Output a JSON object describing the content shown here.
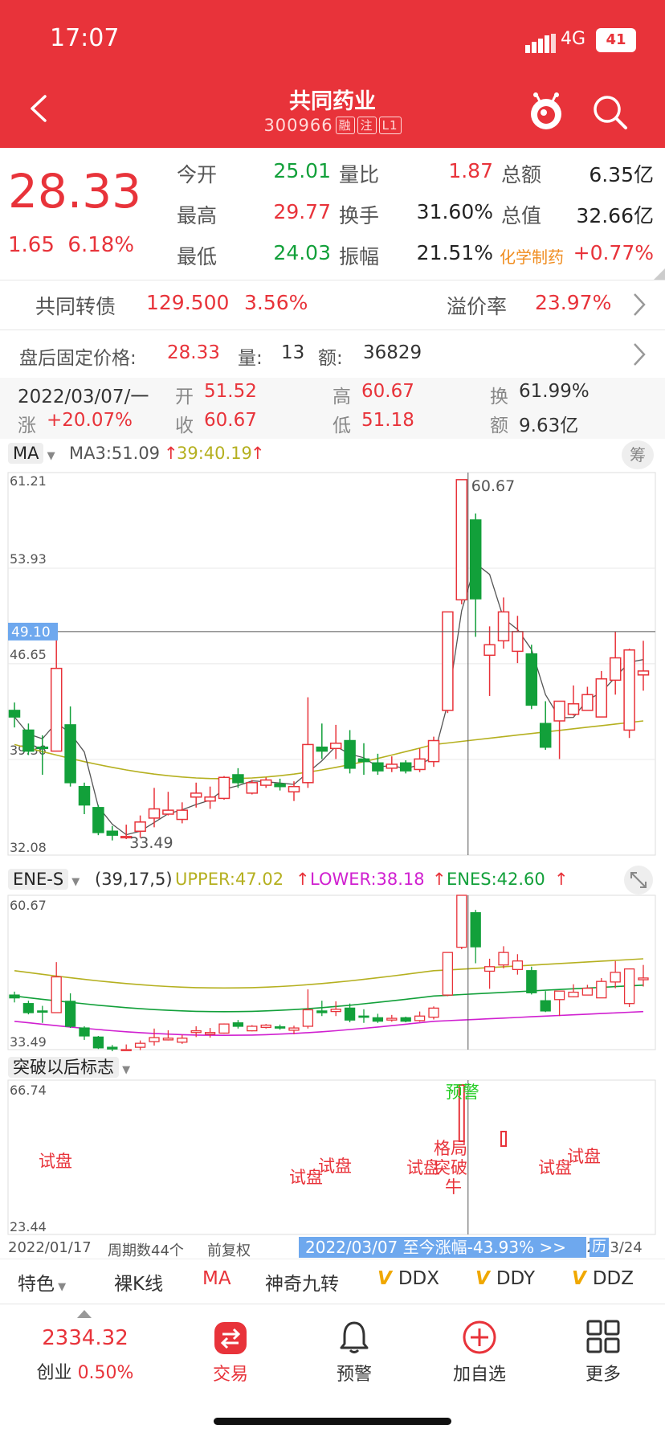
{
  "status": {
    "time": "17:07",
    "network": "4G",
    "battery": "41"
  },
  "header": {
    "title": "共同药业",
    "code": "300966",
    "tags": [
      "融",
      "注",
      "L1"
    ]
  },
  "quote": {
    "price": "28.33",
    "change": "1.65",
    "change_pct": "6.18%",
    "open_label": "今开",
    "open": "25.01",
    "high_label": "最高",
    "high": "29.77",
    "low_label": "最低",
    "low": "24.03",
    "vol_ratio_label": "量比",
    "vol_ratio": "1.87",
    "turnover_label": "换手",
    "turnover": "31.60%",
    "amp_label": "振幅",
    "amp": "21.51%",
    "amount_label": "总额",
    "amount": "6.35亿",
    "mktcap_label": "总值",
    "mktcap": "32.66亿",
    "sector": "化学制药",
    "sector_pct": "+0.77%"
  },
  "bond": {
    "name": "共同转债",
    "price": "129.500",
    "pct": "3.56%",
    "premium_label": "溢价率",
    "premium": "23.97%"
  },
  "afterhours": {
    "label": "盘后固定价格:",
    "price": "28.33",
    "vol_label": "量:",
    "vol": "13",
    "amt_label": "额:",
    "amt": "36829"
  },
  "dayinfo": {
    "date": "2022/03/07/一",
    "open_label": "开",
    "open": "51.52",
    "high_label": "高",
    "high": "60.67",
    "turn_label": "换",
    "turn": "61.99%",
    "chg_label": "涨",
    "chg": "+20.07%",
    "close_label": "收",
    "close": "60.67",
    "low_label": "低",
    "low": "51.18",
    "amt_label": "额",
    "amt": "9.63亿"
  },
  "ma_bar": {
    "selector": "MA",
    "ma3": "MA3:51.09",
    "ma39": "39:40.19",
    "chip_button": "筹"
  },
  "main_chart": {
    "axis_labels": [
      "61.21",
      "53.93",
      "46.65",
      "39.36",
      "32.08"
    ],
    "crosshair_value": "49.10",
    "high_label": "60.67",
    "low_label": "33.49"
  },
  "ene_bar": {
    "selector": "ENE-S",
    "params": "(39,17,5)",
    "upper": "UPPER:47.02",
    "lower": "LOWER:38.18",
    "enes": "ENES:42.60"
  },
  "ene_chart": {
    "axis_top": "60.67",
    "axis_bottom": "33.49"
  },
  "signal_bar": {
    "selector": "突破以后标志"
  },
  "signal_chart": {
    "axis_top": "66.74",
    "axis_bottom": "23.44",
    "labels": {
      "warn": "预警",
      "t1": "试盘",
      "t2": "试盘",
      "t3": "试盘",
      "t4": "试盘",
      "t5": "试盘",
      "t6": "试盘",
      "g": "格局",
      "b": "突破",
      "n": "牛"
    }
  },
  "footer_axis": {
    "start": "2022/01/17",
    "periods": "周期数44个",
    "adjust": "前复权",
    "banner": "2022/03/07 至今涨幅-43.93% >>",
    "cal": "历",
    "end": "2022/03/24"
  },
  "tabs": {
    "feature": "特色",
    "naked": "裸K线",
    "ma": "MA",
    "magic": "神奇九转",
    "ddx": "DDX",
    "ddy": "DDY",
    "ddz": "DDZ"
  },
  "nav": {
    "index_value": "2334.32",
    "index_name": "创业",
    "index_pct": "0.50%",
    "trade": "交易",
    "alert": "预警",
    "add": "加自选",
    "more": "更多"
  },
  "colors": {
    "red": "#e8333a",
    "green": "#12a03a",
    "ma_yellow": "#b5b020",
    "magenta": "#d020d0"
  },
  "chart_data": {
    "type": "candlestick",
    "price_range": [
      32.08,
      61.21
    ],
    "candles": [
      {
        "o": 43.1,
        "c": 42.6,
        "h": 43.7,
        "l": 41.8
      },
      {
        "o": 41.6,
        "c": 40.0,
        "h": 42.1,
        "l": 39.7
      },
      {
        "o": 40.3,
        "c": 40.2,
        "h": 41.2,
        "l": 38.2
      },
      {
        "o": 40.0,
        "c": 46.3,
        "h": 48.9,
        "l": 40.0
      },
      {
        "o": 42.0,
        "c": 37.6,
        "h": 43.4,
        "l": 37.3
      },
      {
        "o": 37.3,
        "c": 35.9,
        "h": 37.6,
        "l": 35.2
      },
      {
        "o": 35.7,
        "c": 33.8,
        "h": 35.9,
        "l": 33.6
      },
      {
        "o": 33.9,
        "c": 33.6,
        "h": 34.3,
        "l": 33.2
      },
      {
        "o": 33.4,
        "c": 33.5,
        "h": 34.4,
        "l": 33.3
      },
      {
        "o": 33.9,
        "c": 34.6,
        "h": 35.1,
        "l": 33.4
      },
      {
        "o": 34.9,
        "c": 35.6,
        "h": 37.2,
        "l": 34.2
      },
      {
        "o": 35.2,
        "c": 35.5,
        "h": 36.9,
        "l": 35.1
      },
      {
        "o": 34.8,
        "c": 35.5,
        "h": 36.1,
        "l": 34.5
      },
      {
        "o": 36.5,
        "c": 36.8,
        "h": 37.6,
        "l": 35.7
      },
      {
        "o": 36.2,
        "c": 36.5,
        "h": 37.3,
        "l": 35.6
      },
      {
        "o": 36.4,
        "c": 38.0,
        "h": 38.1,
        "l": 36.3
      },
      {
        "o": 38.2,
        "c": 37.6,
        "h": 38.7,
        "l": 37.2
      },
      {
        "o": 36.8,
        "c": 37.6,
        "h": 37.8,
        "l": 36.7
      },
      {
        "o": 37.4,
        "c": 37.8,
        "h": 38.0,
        "l": 37.2
      },
      {
        "o": 37.5,
        "c": 37.3,
        "h": 37.9,
        "l": 37.0
      },
      {
        "o": 36.9,
        "c": 37.3,
        "h": 37.7,
        "l": 36.2
      },
      {
        "o": 37.6,
        "c": 40.5,
        "h": 44.1,
        "l": 37.2
      },
      {
        "o": 40.3,
        "c": 40.0,
        "h": 42.1,
        "l": 39.4
      },
      {
        "o": 40.2,
        "c": 40.6,
        "h": 42.0,
        "l": 39.4
      },
      {
        "o": 40.8,
        "c": 38.7,
        "h": 41.6,
        "l": 38.3
      },
      {
        "o": 39.4,
        "c": 39.2,
        "h": 40.6,
        "l": 38.2
      },
      {
        "o": 39.1,
        "c": 38.5,
        "h": 39.8,
        "l": 38.2
      },
      {
        "o": 38.7,
        "c": 39.0,
        "h": 39.6,
        "l": 38.4
      },
      {
        "o": 39.1,
        "c": 38.5,
        "h": 39.3,
        "l": 38.3
      },
      {
        "o": 38.6,
        "c": 39.4,
        "h": 40.2,
        "l": 38.4
      },
      {
        "o": 39.2,
        "c": 40.8,
        "h": 41.1,
        "l": 38.8
      },
      {
        "o": 43.1,
        "c": 50.6,
        "h": 50.6,
        "l": 42.9
      },
      {
        "o": 51.52,
        "c": 60.67,
        "h": 60.67,
        "l": 51.18
      },
      {
        "o": 57.6,
        "c": 51.6,
        "h": 58.1,
        "l": 48.7
      },
      {
        "o": 47.3,
        "c": 48.1,
        "h": 49.5,
        "l": 44.2
      },
      {
        "o": 48.4,
        "c": 50.6,
        "h": 51.7,
        "l": 47.8
      },
      {
        "o": 47.6,
        "c": 49.1,
        "h": 50.3,
        "l": 46.7
      },
      {
        "o": 47.4,
        "c": 43.5,
        "h": 48.1,
        "l": 43.2
      },
      {
        "o": 42.1,
        "c": 40.3,
        "h": 43.8,
        "l": 40.1
      },
      {
        "o": 42.3,
        "c": 43.8,
        "h": 43.8,
        "l": 39.4
      },
      {
        "o": 42.8,
        "c": 43.6,
        "h": 45.0,
        "l": 42.7
      },
      {
        "o": 43.1,
        "c": 44.3,
        "h": 44.9,
        "l": 43.2
      },
      {
        "o": 42.6,
        "c": 45.5,
        "h": 46.1,
        "l": 42.6
      },
      {
        "o": 45.4,
        "c": 47.1,
        "h": 49.1,
        "l": 44.3
      },
      {
        "o": 41.6,
        "c": 47.7,
        "h": 47.8,
        "l": 41.0
      },
      {
        "o": 45.8,
        "c": 46.1,
        "h": 48.4,
        "l": 44.6
      }
    ]
  }
}
